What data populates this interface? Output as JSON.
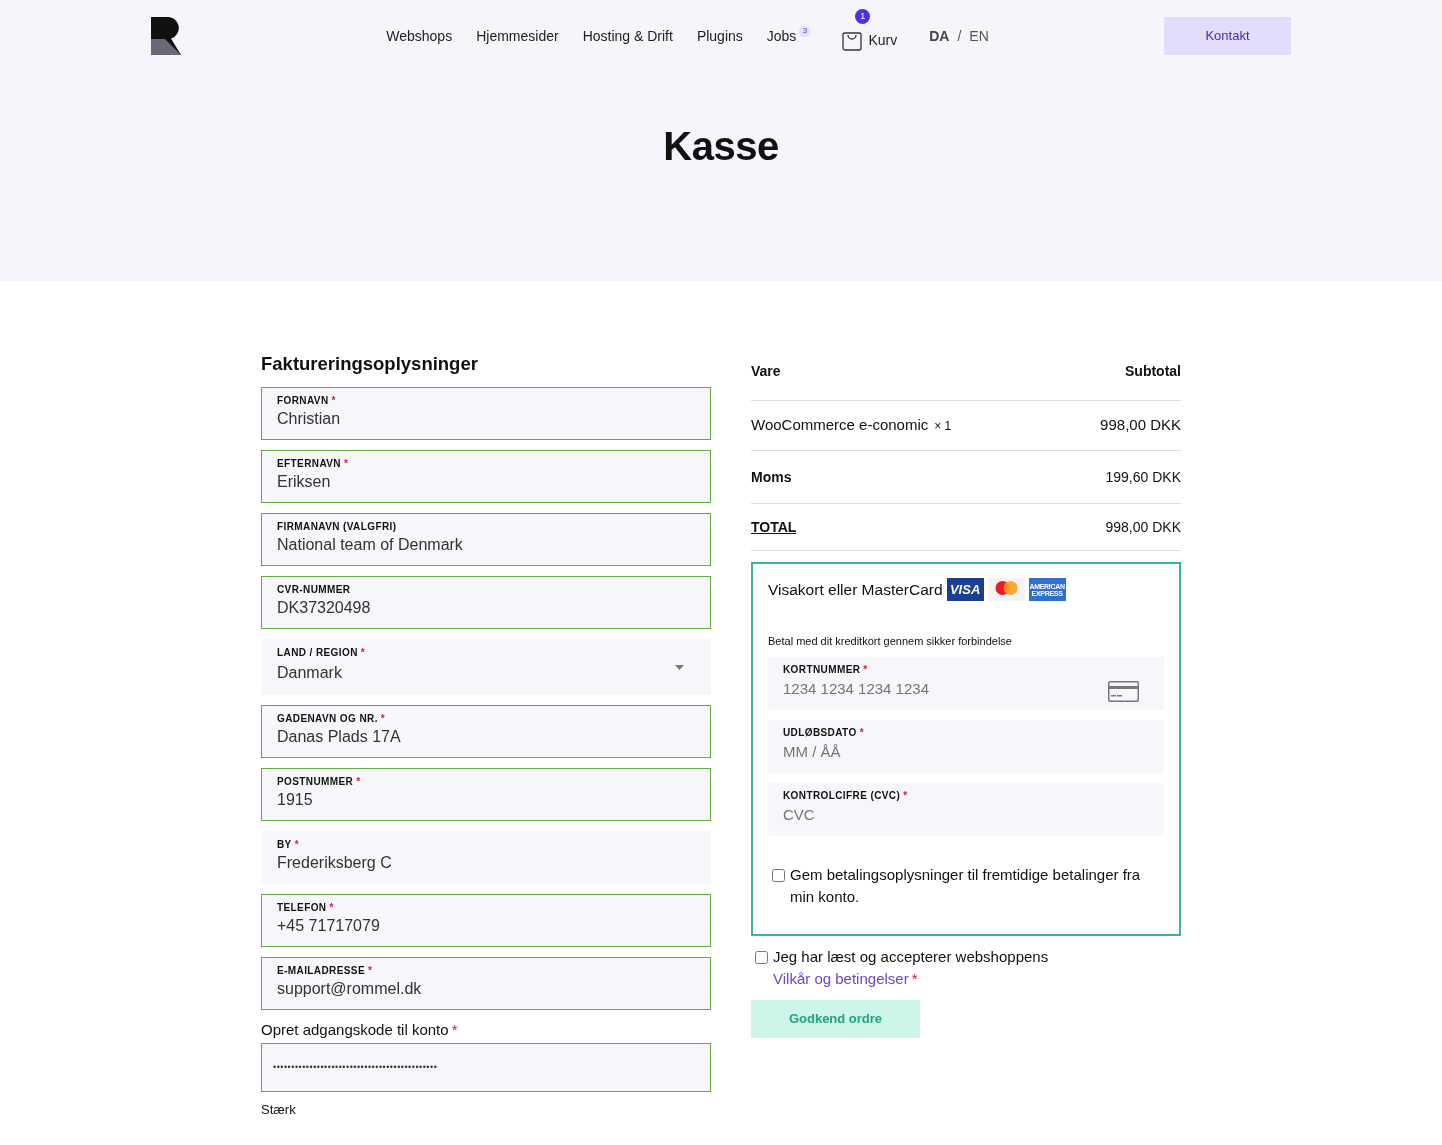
{
  "nav": {
    "links": [
      {
        "label": "Webshops"
      },
      {
        "label": "Hjemmesider"
      },
      {
        "label": "Hosting & Drift"
      },
      {
        "label": "Plugins"
      },
      {
        "label": "Jobs",
        "badge": "3"
      }
    ],
    "cart": {
      "label": "Kurv",
      "count": "1"
    },
    "languages": [
      {
        "label": "DA",
        "selected": true
      },
      {
        "label": "EN",
        "selected": false
      }
    ],
    "language_separator": "/",
    "contact_button": "Kontakt"
  },
  "page_title": "Kasse",
  "required_mark": "*",
  "billing": {
    "heading": "Faktureringsoplysninger",
    "fields": [
      {
        "kind": "text",
        "label": "FORNAVN",
        "required": true,
        "value": "Christian",
        "valid": true
      },
      {
        "kind": "text",
        "label": "EFTERNAVN",
        "required": true,
        "value": "Eriksen",
        "valid": true
      },
      {
        "kind": "text",
        "label": "FIRMANAVN (VALGFRI)",
        "required": false,
        "value": "National team of Denmark",
        "valid": true
      },
      {
        "kind": "text",
        "label": "CVR-NUMMER",
        "required": false,
        "value": "DK37320498",
        "valid": true
      },
      {
        "kind": "select",
        "label": "LAND / REGION",
        "required": true,
        "value": "Danmark",
        "valid": false
      },
      {
        "kind": "text",
        "label": "GADENAVN OG NR.",
        "required": true,
        "value": "Danas Plads 17A",
        "valid": true
      },
      {
        "kind": "text",
        "label": "POSTNUMMER",
        "required": true,
        "value": "1915",
        "valid": true
      },
      {
        "kind": "text",
        "label": "BY",
        "required": true,
        "value": "Frederiksberg C",
        "valid": false
      },
      {
        "kind": "text",
        "label": "TELEFON",
        "required": true,
        "value": "+45 71717079",
        "valid": true
      },
      {
        "kind": "text",
        "label": "E-MAILADRESSE",
        "required": true,
        "value": "support@rommel.dk",
        "valid": true
      }
    ],
    "password": {
      "label": "Opret adgangskode til konto",
      "required": true,
      "value": "•••••••••••••••••••••••••••••••••••••••••••••",
      "valid": true
    },
    "strength": "Stærk"
  },
  "order": {
    "columns": [
      "Vare",
      "Subtotal"
    ],
    "rows": [
      {
        "kind": "item",
        "label": "WooCommerce e-conomic",
        "quantity": "× 1",
        "amount": "998,00 DKK"
      },
      {
        "kind": "tax",
        "label": "Moms",
        "amount": "199,60 DKK"
      },
      {
        "kind": "total",
        "label": "TOTAL",
        "amount": "998,00 DKK"
      }
    ]
  },
  "payment": {
    "method": "Visakort eller MasterCard",
    "card_logos": [
      {
        "kind": "visa",
        "text": "VISA"
      },
      {
        "kind": "mastercard"
      },
      {
        "kind": "amex",
        "text": "AMERICAN EXPRESS"
      }
    ],
    "description": "Betal med dit kreditkort gennem sikker forbindelse",
    "fields": [
      {
        "label": "KORTNUMMER",
        "required": true,
        "placeholder": "1234 1234 1234 1234",
        "card_icon": true
      },
      {
        "label": "UDLØBSDATO",
        "required": true,
        "placeholder": "MM / ÅÅ",
        "card_icon": false
      },
      {
        "label": "KONTROLCIFRE (CVC)",
        "required": true,
        "placeholder": "CVC",
        "card_icon": false
      }
    ],
    "save": {
      "label": "Gem betalingsoplysninger til fremtidige betalinger fra min konto.",
      "checked": false
    }
  },
  "terms": {
    "text": "Jeg har læst og accepterer webshoppens",
    "link": "Vilkår og betingelser",
    "required": true,
    "checked": false
  },
  "submit": "Godkend ordre"
}
